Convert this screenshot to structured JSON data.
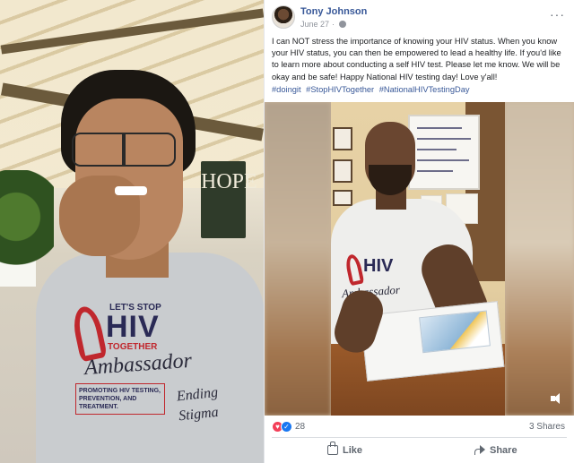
{
  "post": {
    "author": "Tony Johnson",
    "date": "June 27",
    "text": "I can NOT stress the importance of knowing your HIV status. When you know your HIV status, you can then be empowered to lead a healthy life. If you'd like to learn more about conducting a self HIV test. Please let me know. We will be okay and be safe! Happy National HIV testing day! Love y'all!",
    "hashtags": [
      "#doingit",
      "#StopHIVTogether",
      "#NationalHIVTestingDay"
    ],
    "reaction_count": "28",
    "shares": "3 Shares",
    "actions": {
      "like": "Like",
      "share": "Share"
    }
  },
  "left_photo": {
    "sign_text": "HOPE",
    "shirt": {
      "lets_stop": "LET'S STOP",
      "hiv": "HIV",
      "together": "TOGETHER",
      "ambassador": "Ambassador",
      "promo": "PROMOTING HIV TESTING, PREVENTION, AND TREATMENT.",
      "ending": "Ending Stigma"
    }
  },
  "video": {
    "shirt_hiv": "HIV",
    "shirt_ambassador": "Ambassador"
  },
  "colors": {
    "link_blue": "#385898",
    "text": "#1c1e21",
    "muted": "#606770",
    "ribbon_red": "#c0272d"
  }
}
